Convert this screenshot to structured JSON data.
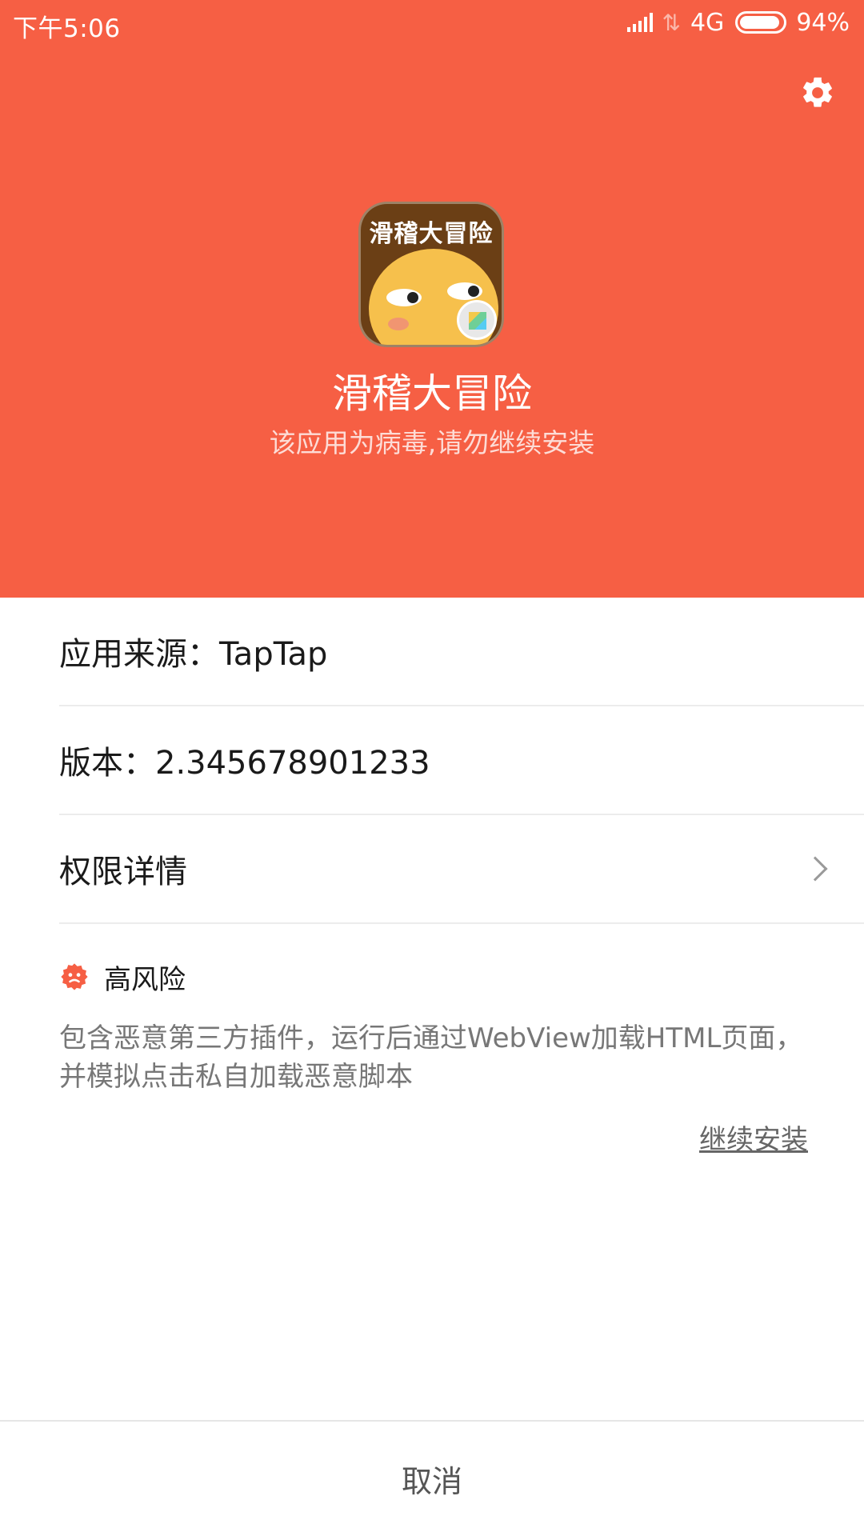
{
  "status_bar": {
    "time": "下午5:06",
    "network": "4G",
    "battery": "94%",
    "battery_level": 0.94
  },
  "header": {
    "background_color": "#f65f44",
    "settings_icon": "gear-icon",
    "app_icon_text": "滑稽大冒险",
    "app_name": "滑稽大冒险",
    "warning": "该应用为病毒,请勿继续安装"
  },
  "details": {
    "source": "应用来源：TapTap",
    "version": "版本：2.345678901233",
    "permissions": "权限详情"
  },
  "risk": {
    "icon": "danger-icon",
    "color": "#f65f44",
    "level": "高风险",
    "description": "包含恶意第三方插件，运行后通过WebView加载HTML页面，并模拟点击私自加载恶意脚本",
    "continue_label": "继续安装"
  },
  "footer": {
    "cancel_label": "取消"
  }
}
